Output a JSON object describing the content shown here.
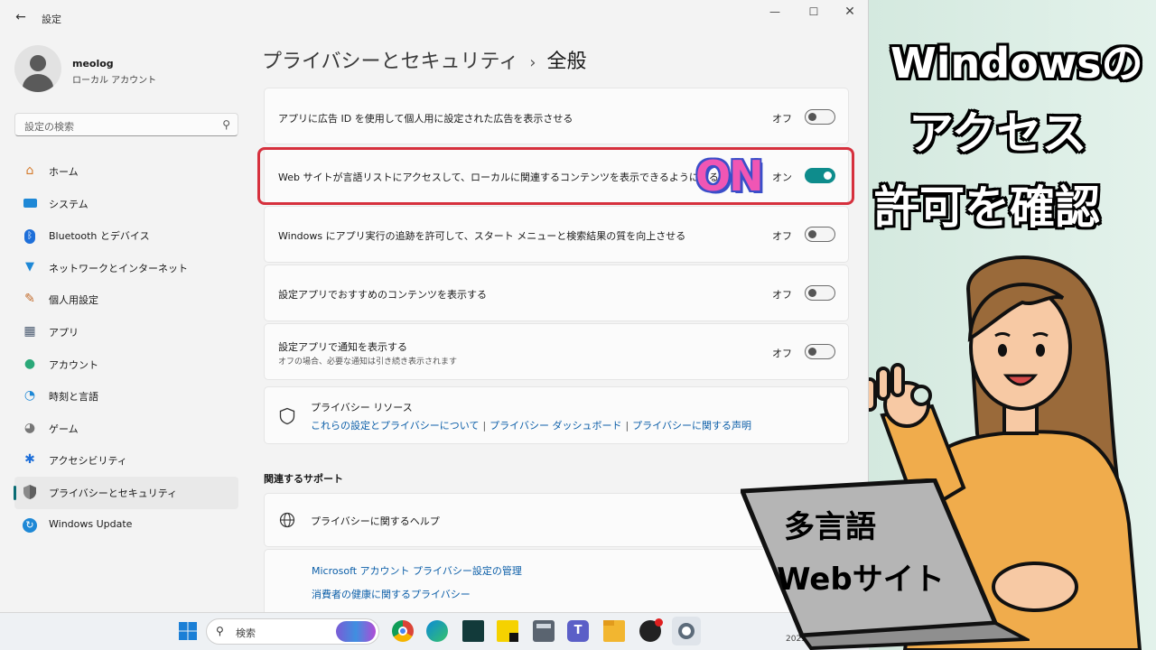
{
  "window": {
    "app_title": "設定",
    "back": "←",
    "minimize": "—",
    "maximize": "☐",
    "close": "✕"
  },
  "user": {
    "name": "meolog",
    "account_type": "ローカル アカウント"
  },
  "search": {
    "placeholder": "設定の検索",
    "icon": "search-icon"
  },
  "sidebar": {
    "items": [
      {
        "label": "ホーム",
        "icon": "home-icon",
        "color": "#d47a2a"
      },
      {
        "label": "システム",
        "icon": "monitor-icon",
        "color": "#1e88d6"
      },
      {
        "label": "Bluetooth とデバイス",
        "icon": "bluetooth-icon",
        "color": "#1e6fd9"
      },
      {
        "label": "ネットワークとインターネット",
        "icon": "wifi-icon",
        "color": "#1e88d6"
      },
      {
        "label": "個人用設定",
        "icon": "brush-icon",
        "color": "#c26a2a"
      },
      {
        "label": "アプリ",
        "icon": "apps-icon",
        "color": "#4a5a70"
      },
      {
        "label": "アカウント",
        "icon": "person-icon",
        "color": "#2aa878"
      },
      {
        "label": "時刻と言語",
        "icon": "globe-clock-icon",
        "color": "#1e88d6"
      },
      {
        "label": "ゲーム",
        "icon": "gamepad-icon",
        "color": "#777777"
      },
      {
        "label": "アクセシビリティ",
        "icon": "accessibility-icon",
        "color": "#1e6fd9"
      },
      {
        "label": "プライバシーとセキュリティ",
        "icon": "shield-icon",
        "color": "#6a6a6a",
        "active": true
      },
      {
        "label": "Windows Update",
        "icon": "update-icon",
        "color": "#1e88d6"
      }
    ]
  },
  "main": {
    "breadcrumb_parent": "プライバシーとセキュリティ",
    "breadcrumb_sep": "›",
    "breadcrumb_current": "全般",
    "settings": [
      {
        "label": "アプリに広告 ID を使用して個人用に設定された広告を表示させる",
        "state": "オフ",
        "on": false
      },
      {
        "label": "Web サイトが言語リストにアクセスして、ローカルに関連するコンテンツを表示できるようにする",
        "state": "オン",
        "on": true
      },
      {
        "label": "Windows にアプリ実行の追跡を許可して、スタート メニューと検索結果の質を向上させる",
        "state": "オフ",
        "on": false
      },
      {
        "label": "設定アプリでおすすめのコンテンツを表示する",
        "state": "オフ",
        "on": false
      },
      {
        "label": "設定アプリで通知を表示する",
        "sub": "オフの場合、必要な通知は引き続き表示されます",
        "state": "オフ",
        "on": false
      }
    ],
    "resources": {
      "title": "プライバシー リソース",
      "links": [
        "これらの設定とプライバシーについて",
        "プライバシー ダッシュボード",
        "プライバシーに関する声明"
      ],
      "separator": "|"
    },
    "related_title": "関連するサポート",
    "help_label": "プライバシーに関するヘルプ",
    "help_links": [
      "Microsoft アカウント プライバシー設定の管理",
      "消費者の健康に関するプライバシー"
    ]
  },
  "annotation": {
    "on_label": "ON",
    "highlight_color": "#d6303d"
  },
  "taskbar": {
    "search_placeholder": "検索",
    "date": "2025/06/25 水",
    "apps": [
      "windows-start-icon",
      "chrome-icon",
      "edge-icon",
      "dark-app-icon",
      "sticky-notes-icon",
      "calculator-icon",
      "teams-icon",
      "file-explorer-icon",
      "media-icon",
      "settings-gear-icon"
    ]
  },
  "overlay": {
    "caption_lines": [
      "Windowsの",
      "アクセス",
      "許可を確認"
    ],
    "laptop_lines": [
      "多言語",
      "Webサイト"
    ]
  }
}
